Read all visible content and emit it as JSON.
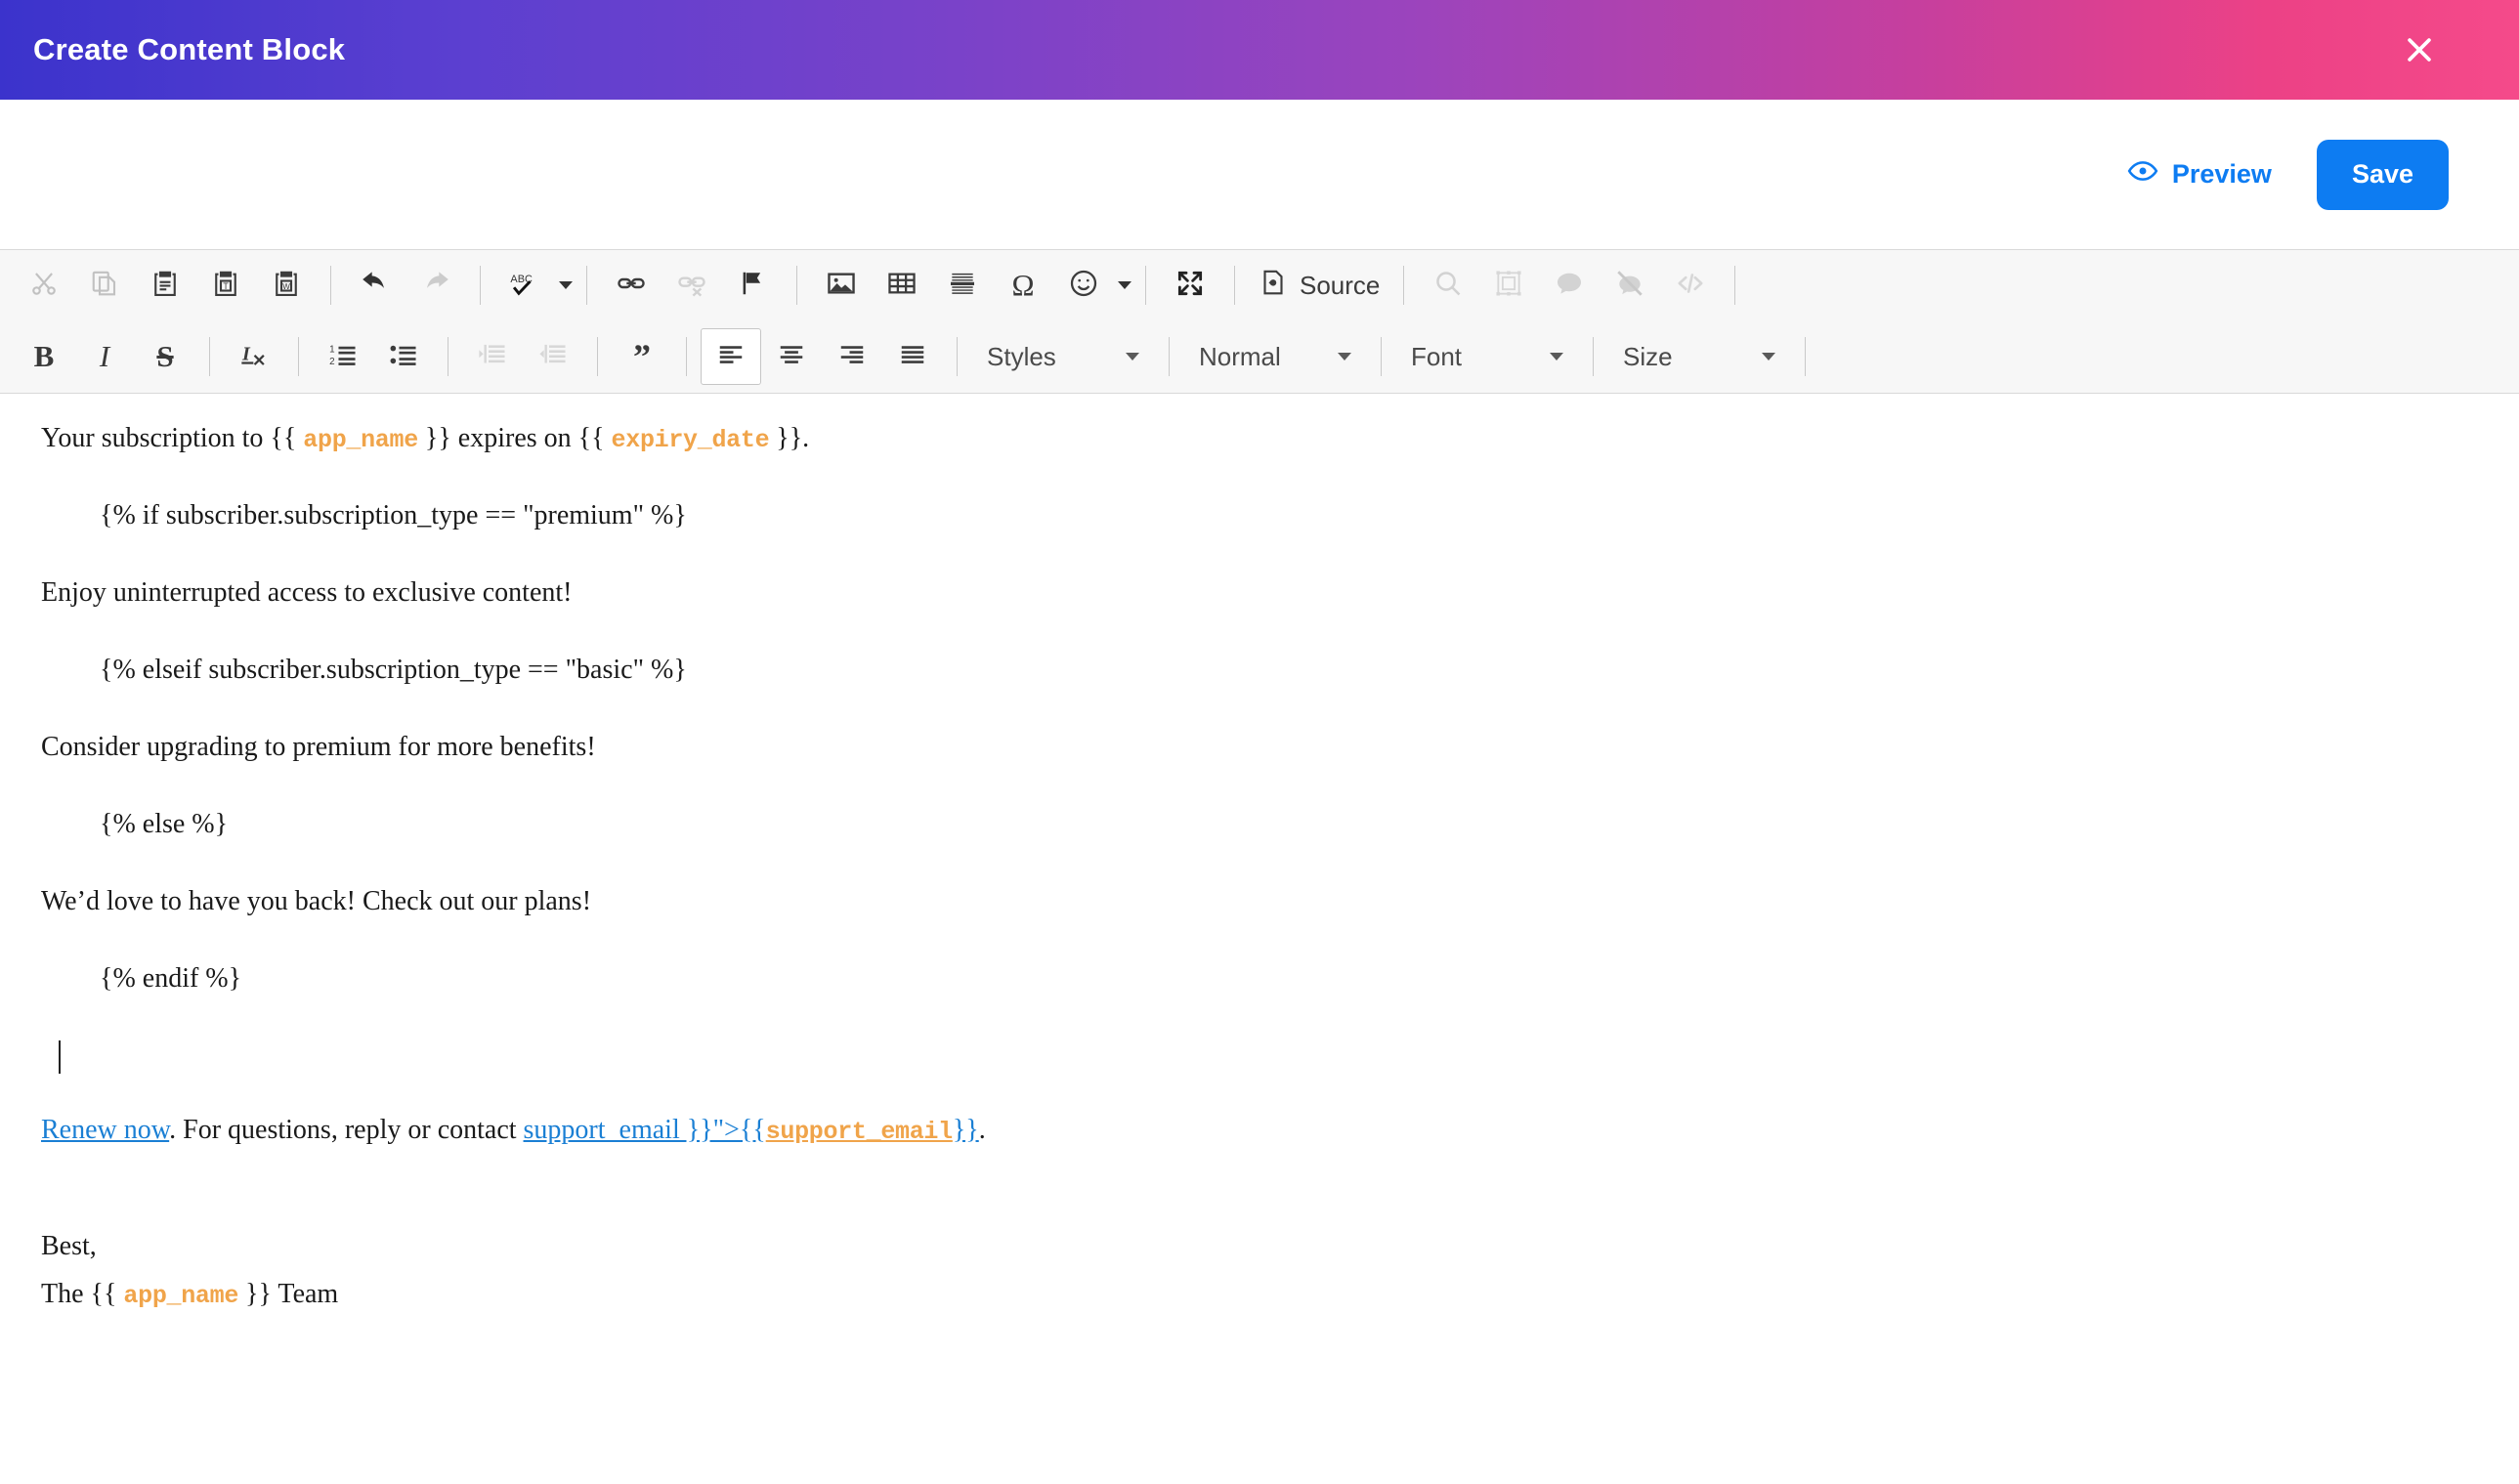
{
  "modal": {
    "title": "Create Content Block",
    "close_icon": "close-icon"
  },
  "actions": {
    "preview_label": "Preview",
    "preview_icon": "eye-icon",
    "save_label": "Save",
    "accent_color": "#0d7cf2"
  },
  "toolbar": {
    "row1": [
      {
        "name": "cut",
        "icon": "scissors-icon",
        "title": "Cut",
        "disabled": true
      },
      {
        "name": "copy",
        "icon": "copy-icon",
        "title": "Copy",
        "disabled": true
      },
      {
        "name": "paste",
        "icon": "paste-icon",
        "title": "Paste",
        "disabled": false
      },
      {
        "name": "paste-text",
        "icon": "paste-as-plain-text-icon",
        "title": "Paste as plain text",
        "disabled": false
      },
      {
        "name": "paste-word",
        "icon": "paste-from-word-icon",
        "title": "Paste from Word",
        "disabled": false
      },
      {
        "name": "undo",
        "icon": "undo-arrow-icon",
        "title": "Undo",
        "disabled": false
      },
      {
        "name": "redo",
        "icon": "redo-arrow-icon",
        "title": "Redo",
        "disabled": true
      },
      {
        "name": "spellcheck",
        "icon": "abc-spellcheck-icon",
        "title": "Spell Check As You Type",
        "disabled": false
      },
      {
        "name": "link",
        "icon": "link-icon",
        "title": "Link",
        "disabled": false
      },
      {
        "name": "unlink",
        "icon": "unlink-icon",
        "title": "Unlink",
        "disabled": true
      },
      {
        "name": "anchor",
        "icon": "flag-anchor-icon",
        "title": "Anchor",
        "disabled": false
      },
      {
        "name": "image",
        "icon": "image-icon",
        "title": "Image",
        "disabled": false
      },
      {
        "name": "table",
        "icon": "table-icon",
        "title": "Table",
        "disabled": false
      },
      {
        "name": "horizontal-rule",
        "icon": "horizontal-rule-icon",
        "title": "Horizontal Line",
        "disabled": false
      },
      {
        "name": "special-char",
        "icon": "omega-icon",
        "title": "Insert Special Character",
        "disabled": false
      },
      {
        "name": "smiley",
        "icon": "smiley-icon",
        "title": "Smiley",
        "disabled": false
      },
      {
        "name": "maximize",
        "icon": "maximize-icon",
        "title": "Maximize",
        "disabled": false
      },
      {
        "name": "source",
        "icon": "source-document-icon",
        "title": "Source",
        "disabled": false
      },
      {
        "name": "find",
        "icon": "magnifier-icon",
        "title": "Find",
        "disabled": true
      },
      {
        "name": "image-resize",
        "icon": "image-resize-icon",
        "title": "Image Resize",
        "disabled": true
      },
      {
        "name": "comment",
        "icon": "speech-bubble-icon",
        "title": "Comment",
        "disabled": true
      },
      {
        "name": "hide-marker",
        "icon": "hide-marker-icon",
        "title": "Hide Marker",
        "disabled": true
      },
      {
        "name": "code-snippet",
        "icon": "code-tags-icon",
        "title": "Code Snippet",
        "disabled": true
      }
    ],
    "source_label": "Source",
    "row2": [
      {
        "name": "bold",
        "icon": "bold-icon",
        "glyph": "B",
        "title": "Bold"
      },
      {
        "name": "italic",
        "icon": "italic-icon",
        "glyph": "I",
        "title": "Italic"
      },
      {
        "name": "strikethrough",
        "icon": "strikethrough-icon",
        "glyph": "S",
        "title": "Strikethrough"
      },
      {
        "name": "remove-format",
        "icon": "remove-format-icon",
        "title": "Remove Format"
      },
      {
        "name": "numbered-list",
        "icon": "numbered-list-icon",
        "title": "Insert/Remove Numbered List"
      },
      {
        "name": "bulleted-list",
        "icon": "bulleted-list-icon",
        "title": "Insert/Remove Bulleted List"
      },
      {
        "name": "outdent",
        "icon": "outdent-icon",
        "title": "Decrease Indent",
        "disabled": true
      },
      {
        "name": "indent",
        "icon": "indent-icon",
        "title": "Increase Indent",
        "disabled": true
      },
      {
        "name": "blockquote",
        "icon": "blockquote-icon",
        "title": "Block Quote"
      },
      {
        "name": "align-left",
        "icon": "align-left-icon",
        "title": "Align Left",
        "active": true
      },
      {
        "name": "align-center",
        "icon": "align-center-icon",
        "title": "Center"
      },
      {
        "name": "align-right",
        "icon": "align-right-icon",
        "title": "Align Right"
      },
      {
        "name": "justify",
        "icon": "justify-icon",
        "title": "Justify"
      }
    ],
    "dropdowns": [
      {
        "name": "styles",
        "label": "Styles"
      },
      {
        "name": "paragraph-format",
        "label": "Normal"
      },
      {
        "name": "font-family",
        "label": "Font"
      },
      {
        "name": "font-size",
        "label": "Size"
      }
    ]
  },
  "editor": {
    "line1": {
      "pre": "Your subscription to {{",
      "var1": "app_name",
      "mid": "}} expires on {{",
      "var2": "expiry_date",
      "post": "}}."
    },
    "if_premium": "{% if subscriber.subscription_type == \"premium\" %}",
    "premium_text": "Enjoy uninterrupted access to exclusive content!",
    "elseif_basic": "{% elseif subscriber.subscription_type == \"basic\" %}",
    "basic_text": "Consider upgrading to premium for more benefits!",
    "else_tag": "{% else %}",
    "else_text": "We’d love to have you back! Check out our plans!",
    "endif_tag": "{% endif %}",
    "link_line": {
      "link_text": "Renew now",
      "after_link": ". For questions, reply or contact ",
      "broken_link_text": "support_email }}\">{{",
      "broken_var": "support_email",
      "broken_tail": "}}",
      "period": "."
    },
    "closing1": "Best,",
    "closing2": {
      "pre": "The {{",
      "var": "app_name",
      "post": "}} Team"
    },
    "variable_color": "#f0a44a",
    "link_color": "#1a7fd4"
  }
}
